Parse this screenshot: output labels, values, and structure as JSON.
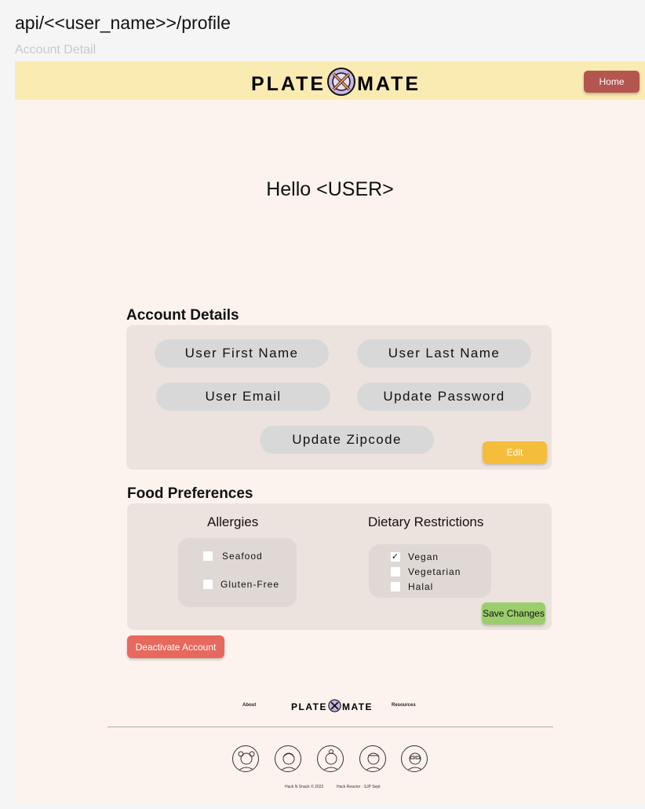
{
  "route": "api/<<user_name>>/profile",
  "frame_label": "Account Detail",
  "header": {
    "logo_left": "PLATE",
    "logo_right": "MATE",
    "home_label": "Home",
    "background_color": "#faebb3"
  },
  "greeting": "Hello <USER>",
  "account": {
    "title": "Account Details",
    "fields": {
      "first_name": "User First Name",
      "last_name": "User Last Name",
      "email": "User Email",
      "password": "Update Password",
      "zipcode": "Update Zipcode"
    },
    "edit_label": "Edit"
  },
  "food": {
    "title": "Food Preferences",
    "allergies": {
      "title": "Allergies",
      "options": [
        {
          "label": "Seafood",
          "checked": false
        },
        {
          "label": "Gluten-Free",
          "checked": false
        }
      ]
    },
    "diet": {
      "title": "Dietary Restrictions",
      "options": [
        {
          "label": "Vegan",
          "checked": true,
          "mark": "✓"
        },
        {
          "label": "Vegetarian",
          "checked": false,
          "mark": ""
        },
        {
          "label": "Halal",
          "checked": false,
          "mark": ""
        }
      ]
    },
    "save_label": "Save Changes"
  },
  "deactivate_label": "Deactivate Account",
  "footer": {
    "about": "About",
    "resources": "Resources",
    "logo_left": "PLATE",
    "logo_right": "MATE",
    "credit_left": "Hack N Snack © 2022",
    "credit_right": "Hack Reactor · SJP Sept"
  },
  "colors": {
    "page_background": "#fdf3ee",
    "home_button": "#b4554f",
    "edit_button": "#f4bd3c",
    "save_button": "#9ccd6c",
    "deactivate_button": "#e7685c"
  }
}
